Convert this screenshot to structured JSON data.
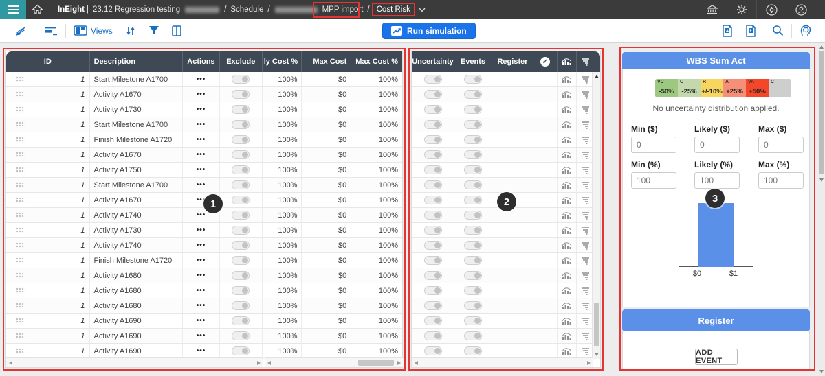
{
  "nav": {
    "brand": "InEight",
    "divider": "|",
    "project": "23.12 Regression testing",
    "sep": "/",
    "schedule": "Schedule",
    "mpp_import": "MPP import",
    "current_view": "Cost Risk"
  },
  "toolbar": {
    "views_label": "Views",
    "run_simulation_label": "Run simulation"
  },
  "table1": {
    "headers": [
      "ID",
      "Description",
      "Actions",
      "Exclude",
      "ly Cost %",
      "Max Cost",
      "Max Cost %"
    ],
    "actions_glyph": "•••",
    "rows": [
      {
        "id": "1",
        "description": "Start Milestone A1700"
      },
      {
        "id": "1",
        "description": "Activity A1670"
      },
      {
        "id": "1",
        "description": "Activity A1730"
      },
      {
        "id": "1",
        "description": "Start Milestone A1700"
      },
      {
        "id": "1",
        "description": "Finish Milestone A1720"
      },
      {
        "id": "1",
        "description": "Activity A1670"
      },
      {
        "id": "1",
        "description": "Activity A1750"
      },
      {
        "id": "1",
        "description": "Start Milestone A1700"
      },
      {
        "id": "1",
        "description": "Activity A1670"
      },
      {
        "id": "1",
        "description": "Activity A1740"
      },
      {
        "id": "1",
        "description": "Activity A1730"
      },
      {
        "id": "1",
        "description": "Activity A1740"
      },
      {
        "id": "1",
        "description": "Finish Milestone A1720"
      },
      {
        "id": "1",
        "description": "Activity A1680"
      },
      {
        "id": "1",
        "description": "Activity A1680"
      },
      {
        "id": "1",
        "description": "Activity A1680"
      },
      {
        "id": "1",
        "description": "Activity A1690"
      },
      {
        "id": "1",
        "description": "Activity A1690"
      },
      {
        "id": "1",
        "description": "Activity A1690"
      }
    ],
    "row_defaults": {
      "likely_cost_pct": "100%",
      "max_cost": "$0",
      "max_cost_pct": "100%",
      "exclude_on": false
    }
  },
  "table2": {
    "headers": [
      "Uncertainty",
      "Events",
      "Register"
    ],
    "icon_headers": [
      "check-circle-icon",
      "distribution-chart-icon",
      "tornado-icon"
    ],
    "row_defaults": {
      "uncertainty_on": false,
      "events_on": false,
      "register": ""
    }
  },
  "panel": {
    "title": "WBS Sum Act",
    "legend": [
      {
        "code": "VC",
        "label": "-50%",
        "color": "#9cc87f"
      },
      {
        "code": "C",
        "label": "-25%",
        "color": "#c3d9ad"
      },
      {
        "code": "R",
        "label": "+/-10%",
        "color": "#f8d55e"
      },
      {
        "code": "A",
        "label": "+25%",
        "color": "#f68f78"
      },
      {
        "code": "VA",
        "label": "+50%",
        "color": "#f4472a"
      },
      {
        "code": "C",
        "label": "",
        "color": "#cecece"
      }
    ],
    "message": "No uncertainty distribution applied.",
    "dollar_fields": [
      {
        "label": "Min ($)",
        "value": "0"
      },
      {
        "label": "Likely ($)",
        "value": "0"
      },
      {
        "label": "Max ($)",
        "value": "0"
      }
    ],
    "percent_fields": [
      {
        "label": "Min (%)",
        "value": "100"
      },
      {
        "label": "Likely (%)",
        "value": "100"
      },
      {
        "label": "Max (%)",
        "value": "100"
      }
    ],
    "chart_data": {
      "type": "bar",
      "x_ticks": [
        "$0",
        "$1"
      ],
      "bars": [
        {
          "x_from": "$0",
          "x_to": "$1",
          "relative_height": 1.0
        }
      ],
      "bar_color": "#5b90e8"
    },
    "register_title": "Register",
    "add_event_label": "ADD EVENT"
  },
  "annotations": {
    "badges": [
      "1",
      "2",
      "3"
    ]
  },
  "colors": {
    "accent_blue": "#1a73e8",
    "toolbar_icon_blue": "#1a6fc0",
    "header_slate": "#3e4955",
    "nav_teal": "#2f98a0",
    "annotation_red": "#e53434",
    "panel_blue": "#5b90e8"
  }
}
